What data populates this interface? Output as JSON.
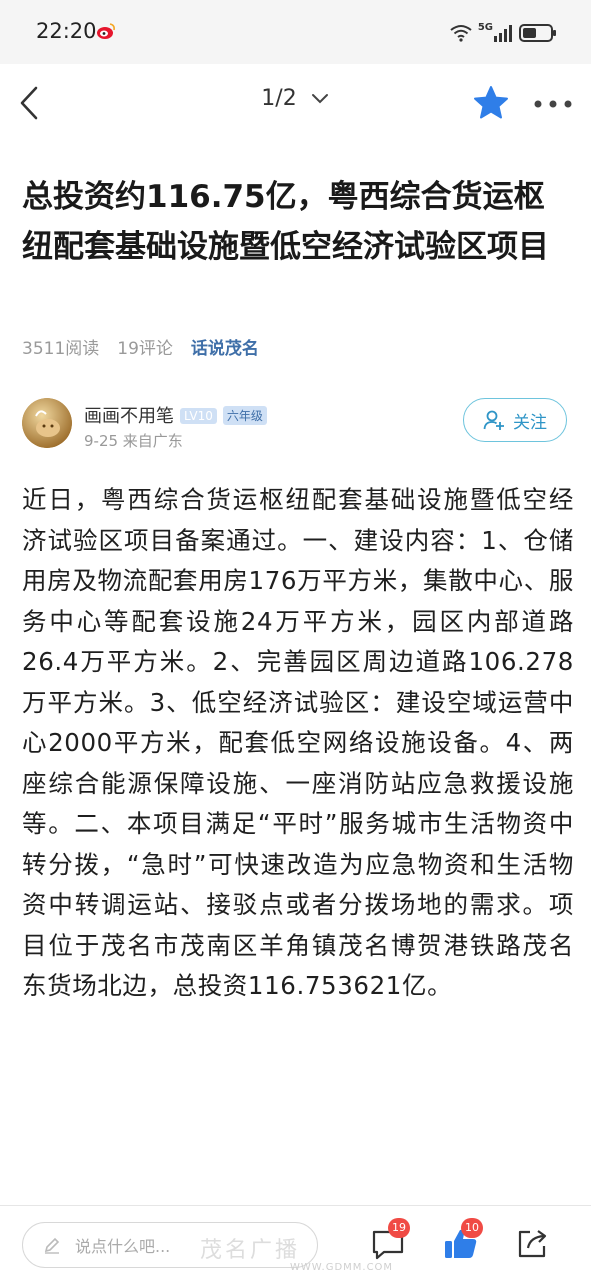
{
  "status_bar": {
    "time": "22:20",
    "network": "5G"
  },
  "nav": {
    "page_indicator": "1/2"
  },
  "article": {
    "title": "总投资约116.75亿，粤西综合货运枢纽配套基础设施暨低空经济试验区项目",
    "reads": "3511阅读",
    "comments": "19评论",
    "topic": "话说茂名",
    "author": {
      "name": "画画不用笔",
      "level_badge": "LV10",
      "grade_badge": "六年级",
      "date_location": "9-25  来自广东"
    },
    "follow_label": "关注",
    "body": "近日，粤西综合货运枢纽配套基础设施暨低空经济试验区项目备案通过。一、建设内容：1、仓储用房及物流配套用房176万平方米，集散中心、服务中心等配套设施24万平方米，园区内部道路26.4万平方米。2、完善园区周边道路106.278万平方米。3、低空经济试验区：建设空域运营中心2000平方米，配套低空网络设施设备。4、两座综合能源保障设施、一座消防站应急救援设施等。二、本项目满足“平时”服务城市生活物资中转分拨，“急时”可快速改造为应急物资和生活物资中转调运站、接驳点或者分拨场地的需求。项目位于茂名市茂南区羊角镇茂名博贺港铁路茂名东货场北边，总投资116.753621亿。"
  },
  "bottom_bar": {
    "comment_placeholder": "说点什么吧...",
    "comment_count": "19",
    "like_count": "10"
  },
  "watermark": {
    "text": "茂名广播",
    "url": "WWW.GDMM.COM"
  },
  "colors": {
    "accent_blue": "#2f7ee8",
    "follow_teal": "#2f95c7",
    "badge_red": "#f04b45",
    "topic_blue": "#3f6fa8"
  }
}
